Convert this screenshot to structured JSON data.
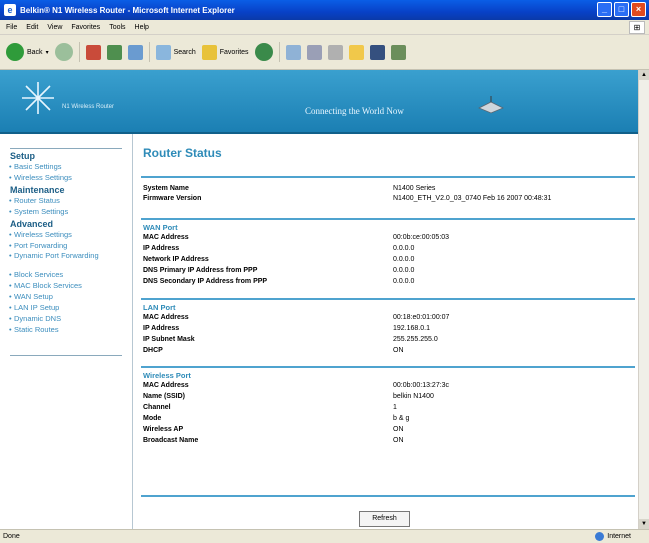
{
  "window": {
    "title": "Belkin® N1 Wireless Router - Microsoft Internet Explorer"
  },
  "menu": [
    "File",
    "Edit",
    "View",
    "Favorites",
    "Tools",
    "Help"
  ],
  "toolbar": {
    "back": "Back",
    "search": "Search",
    "favorites": "Favorites"
  },
  "banner": {
    "brand": "N1 Wireless Router",
    "tagline": "Connecting the World Now"
  },
  "sidebar": {
    "sections": [
      {
        "title": "Setup",
        "items": [
          "Basic Settings",
          "Wireless Settings"
        ]
      },
      {
        "title": "Maintenance",
        "items": [
          "Router Status",
          "System Settings"
        ]
      },
      {
        "title": "Advanced",
        "items": [
          "Wireless Settings",
          "Port Forwarding",
          "Dynamic Port Forwarding",
          "Block Services",
          "MAC Block Services",
          "WAN Setup",
          "LAN IP Setup",
          "Dynamic DNS",
          "Static Routes"
        ]
      }
    ]
  },
  "main": {
    "title": "Router Status",
    "system": [
      {
        "k": "System Name",
        "v": "N1400 Series"
      },
      {
        "k": "Firmware Version",
        "v": "N1400_ETH_V2.0_03_0740 Feb 16 2007 00:48:31"
      }
    ],
    "wan": {
      "title": "WAN Port",
      "rows": [
        {
          "k": "MAC Address",
          "v": "00:0b:ce:00:05:03"
        },
        {
          "k": "IP Address",
          "v": "0.0.0.0"
        },
        {
          "k": "Network IP Address",
          "v": "0.0.0.0"
        },
        {
          "k": "DNS Primary IP Address from PPP",
          "v": "0.0.0.0"
        },
        {
          "k": "DNS Secondary IP Address from PPP",
          "v": "0.0.0.0"
        }
      ]
    },
    "lan": {
      "title": "LAN Port",
      "rows": [
        {
          "k": "MAC Address",
          "v": "00:18:e0:01:00:07"
        },
        {
          "k": "IP Address",
          "v": "192.168.0.1"
        },
        {
          "k": "IP Subnet Mask",
          "v": "255.255.255.0"
        },
        {
          "k": "DHCP",
          "v": "ON"
        }
      ]
    },
    "wireless": {
      "title": "Wireless Port",
      "rows": [
        {
          "k": "MAC Address",
          "v": "00:0b:00:13:27:3c"
        },
        {
          "k": "Name (SSID)",
          "v": "belkin N1400"
        },
        {
          "k": "Channel",
          "v": "1"
        },
        {
          "k": "Mode",
          "v": "b & g"
        },
        {
          "k": "Wireless AP",
          "v": "ON"
        },
        {
          "k": "Broadcast Name",
          "v": "ON"
        }
      ]
    },
    "refresh_label": "Refresh"
  },
  "status": {
    "left": "Done",
    "zone": "Internet"
  }
}
